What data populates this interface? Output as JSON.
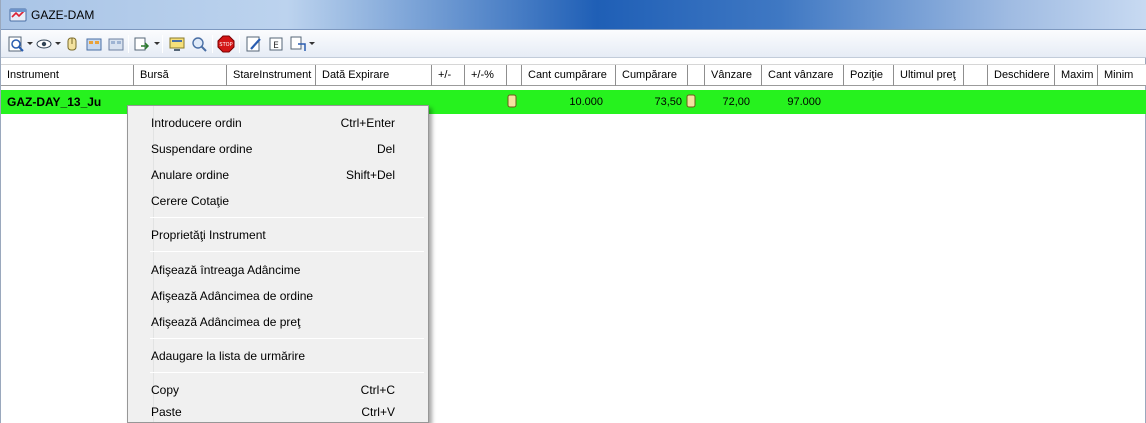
{
  "window": {
    "title": "GAZE-DAM",
    "icon": "market-window-icon"
  },
  "toolbar": {
    "icons": [
      "zoom-icon",
      "eye-icon",
      "hand-icon",
      "orders-icon",
      "orders-alt-icon",
      "transfer-icon",
      "screen-icon",
      "search-icon",
      "stop-icon",
      "edit-icon",
      "export-icon",
      "settings-icon"
    ]
  },
  "grid": {
    "columns": [
      "Instrument",
      "Bursă",
      "StareInstrument",
      "Dată Expirare",
      "+/-",
      "+/-%",
      "Cant cumpărare",
      "Cumpărare",
      "Vânzare",
      "Cant vânzare",
      "Poziţie",
      "Ultimul preţ",
      "Deschidere",
      "Maxim",
      "Minim"
    ],
    "row": {
      "instrument": "GAZ-DAY_13_Ju",
      "cant_cumparare": "10.000",
      "cumparare": "73,50",
      "vanzare": "72,00",
      "cant_vanzare": "97.000",
      "color": "#26f21e"
    }
  },
  "context_menu": {
    "items": [
      {
        "label": "Introducere ordin",
        "shortcut": "Ctrl+Enter"
      },
      {
        "label": "Suspendare ordine",
        "shortcut": "Del"
      },
      {
        "label": "Anulare ordine",
        "shortcut": "Shift+Del"
      },
      {
        "label": "Cerere Cotaţie",
        "shortcut": ""
      },
      {
        "label": "Proprietăţi Instrument",
        "shortcut": ""
      },
      {
        "label": "Afişează întreaga Adâncime",
        "shortcut": ""
      },
      {
        "label": "Afişează Adâncimea de ordine",
        "shortcut": ""
      },
      {
        "label": "Afişează Adâncimea de preţ",
        "shortcut": ""
      },
      {
        "label": "Adaugare la lista de urmărire",
        "shortcut": ""
      },
      {
        "label": "Copy",
        "shortcut": "Ctrl+C"
      },
      {
        "label": "Paste",
        "shortcut": "Ctrl+V"
      }
    ]
  }
}
